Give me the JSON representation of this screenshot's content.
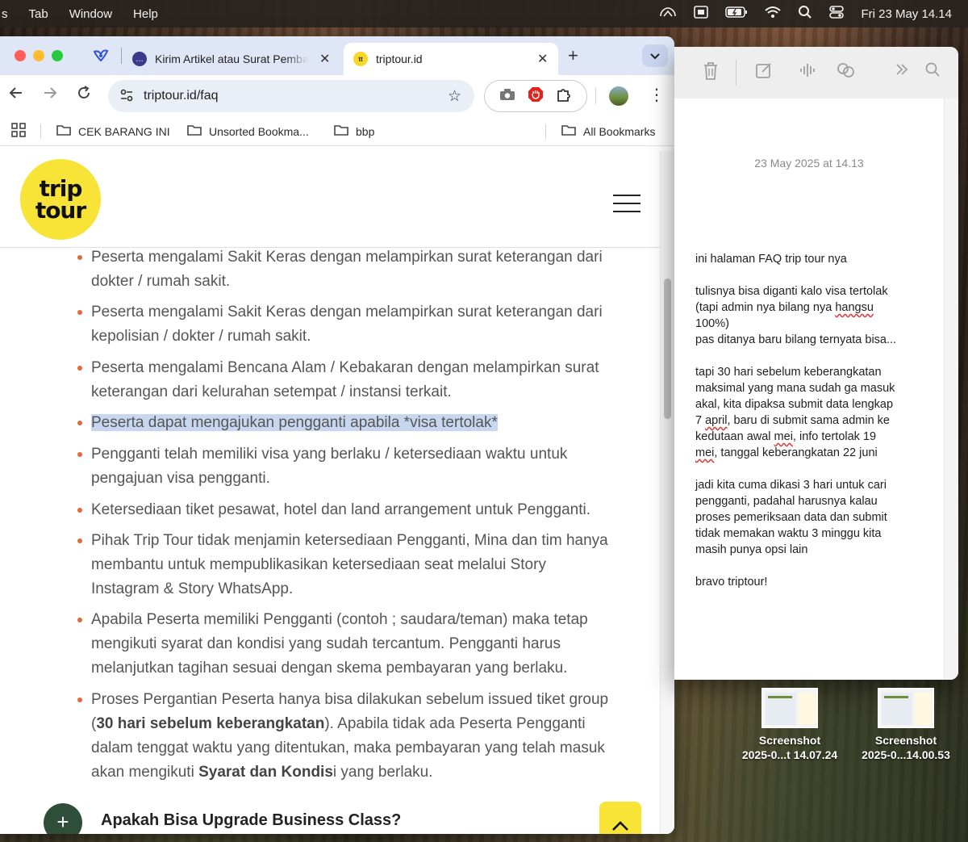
{
  "menubar": {
    "items": [
      "s",
      "Tab",
      "Window",
      "Help"
    ],
    "clock": "Fri 23 May  14.14",
    "status_icons": [
      "creative-cloud-icon",
      "screen-share-icon",
      "battery-icon",
      "wifi-icon",
      "search-icon",
      "control-center-icon"
    ]
  },
  "browser": {
    "tabs": [
      {
        "title": "Kirim Artikel atau Surat Pembaca",
        "active": false
      },
      {
        "title": "triptour.id",
        "active": true
      }
    ],
    "url": "triptour.id/faq",
    "bookmarks": [
      "CEK BARANG INI",
      "Unsorted Bookma...",
      "bbp"
    ],
    "all_bookmarks": "All Bookmarks"
  },
  "site": {
    "logo_line1": "trip",
    "logo_line2": "tour"
  },
  "faq": {
    "items": [
      {
        "line1": "Peserta mengalami Sakit Keras dengan melampirkan surat keterangan dari",
        "line2": "dokter / rumah sakit."
      },
      {
        "line1": "Peserta mengalami Sakit Keras dengan melampirkan surat keterangan dari",
        "line2": "kepolisian / dokter / rumah sakit."
      },
      {
        "line1": "Peserta mengalami Bencana Alam / Kebakaran dengan melampirkan surat",
        "line2": "keterangan dari kelurahan setempat / instansi terkait."
      },
      {
        "line1": "Peserta dapat mengajukan pengganti apabila *visa tertolak*"
      },
      {
        "line1": "Pengganti telah memiliki visa yang berlaku / ketersediaan waktu untuk",
        "line2": "pengajuan visa pengganti."
      },
      {
        "line1": "Ketersediaan tiket pesawat, hotel dan land arrangement untuk Pengganti."
      },
      {
        "line1": "Pihak Trip Tour tidak menjamin ketersediaan Pengganti, Mina dan tim hanya",
        "line2": "membantu untuk mempublikasikan ketersediaan seat melalui Story",
        "line3": "Instagram & Story WhatsApp."
      },
      {
        "line1": "Apabila Peserta memiliki Pengganti (contoh ; saudara/teman) maka tetap",
        "line2": "mengikuti syarat dan kondisi yang sudah tercantum. Pengganti harus",
        "line3": "melanjutkan tagihan sesuai dengan skema pembayaran yang berlaku."
      },
      {
        "line1": "Proses Pergantian Peserta hanya bisa dilakukan sebelum issued tiket group",
        "line2_pre": "(",
        "line2_bold": "30 hari sebelum keberangkatan",
        "line2_post": "). Apabila tidak ada Peserta Pengganti",
        "line3": "dalam tenggat waktu yang ditentukan, maka pembayaran yang telah masuk",
        "line4_pre": "akan mengikuti ",
        "line4_bold": "Syarat dan Kondis",
        "line4_post": "i yang berlaku."
      }
    ],
    "next_question": "Apakah Bisa Upgrade Business Class?"
  },
  "notes": {
    "date": "23 May 2025 at 14.13",
    "lines": [
      "ini halaman FAQ trip tour nya",
      "",
      "tulisnya bisa diganti kalo visa tertolak",
      "(tapi admin nya bilang nya hangsu",
      "100%)",
      "pas ditanya baru bilang ternyata bisa...",
      "",
      "tapi 30 hari sebelum keberangkatan",
      "maksimal yang mana sudah ga masuk",
      "akal, kita dipaksa submit data lengkap",
      "7 april, baru di submit sama admin ke",
      "kedutaan awal mei, info tertolak 19",
      "mei, tanggal keberangkatan 22 juni",
      "",
      "jadi kita cuma dikasi 3 hari untuk cari",
      "pengganti, padahal harusnya kalau",
      "proses pemeriksaan data dan submit",
      "tidak memakan waktu 3 minggu kita",
      "masih punya opsi lain",
      "",
      "bravo triptour!"
    ]
  },
  "desktop": {
    "icons": [
      {
        "line1": "Screenshot",
        "line2": "2025-0...t 14.07.24"
      },
      {
        "line1": "Screenshot",
        "line2": "2025-0...14.00.53"
      }
    ]
  }
}
